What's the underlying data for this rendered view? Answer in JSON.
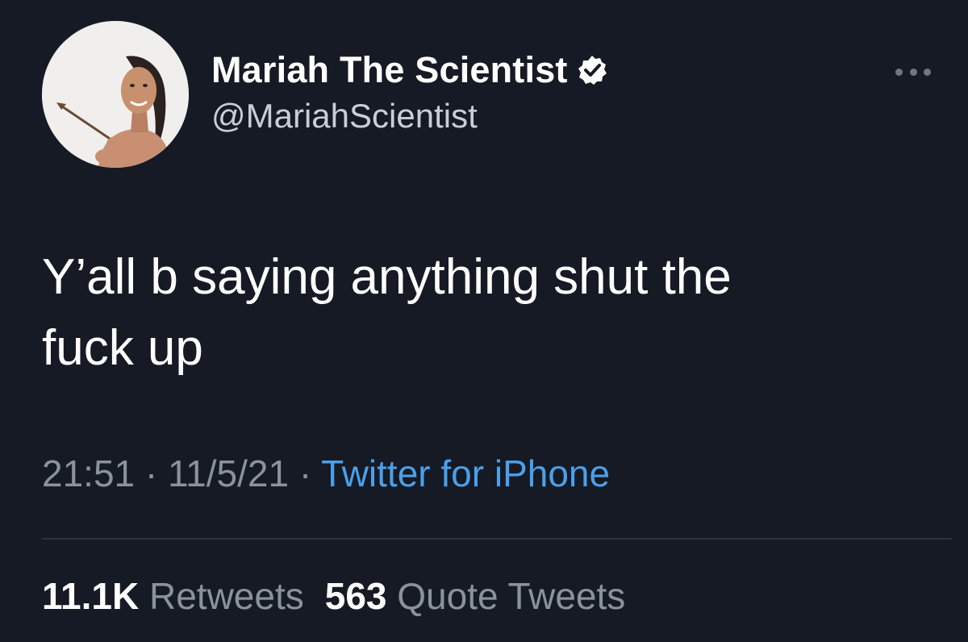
{
  "author": {
    "display_name": "Mariah The Scientist",
    "handle": "@MariahScientist",
    "verified_icon": "verified-badge-icon"
  },
  "tweet": {
    "text": "Y’all b saying anything shut the\nfuck up"
  },
  "meta": {
    "time": "21:51",
    "sep1": " · ",
    "date": "11/5/21",
    "sep2": " · ",
    "source": "Twitter for iPhone"
  },
  "stats": {
    "retweets_count": "11.1K",
    "retweets_label": "Retweets",
    "quotes_count": "563",
    "quotes_label": "Quote Tweets"
  },
  "menu": {
    "icon": "more-options-icon"
  },
  "colors": {
    "background": "#161a25",
    "text": "#ffffff",
    "secondary": "#8a939d",
    "link": "#4c9fe8"
  }
}
